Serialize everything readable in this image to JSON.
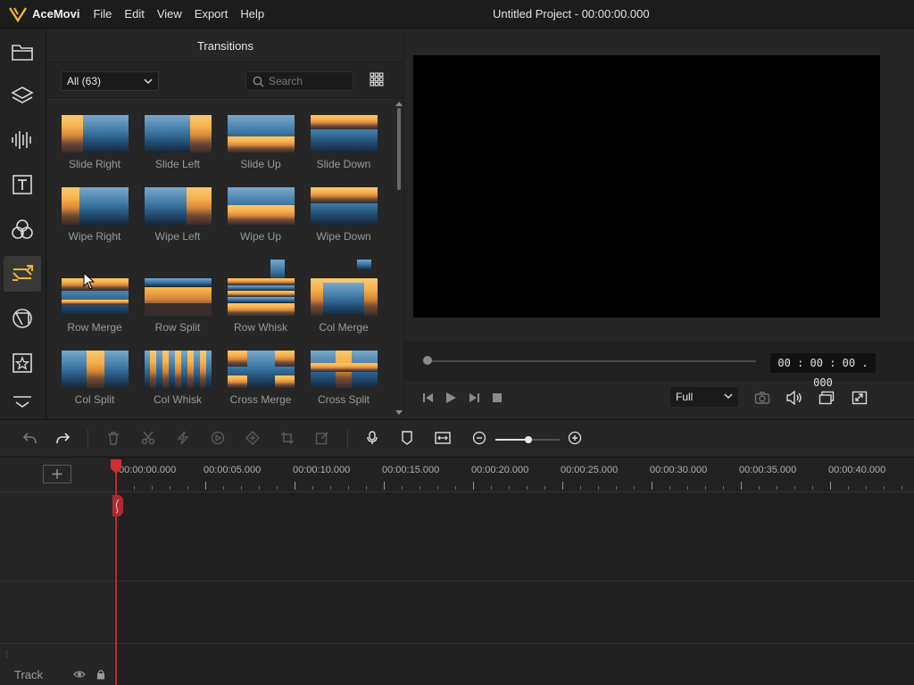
{
  "app": {
    "name": "AceMovi",
    "window_title": "Untitled Project - 00:00:00.000"
  },
  "menu": [
    "File",
    "Edit",
    "View",
    "Export",
    "Help"
  ],
  "sidebar": {
    "items": [
      {
        "icon": "folder-icon"
      },
      {
        "icon": "layers-icon"
      },
      {
        "icon": "audio-wave-icon"
      },
      {
        "icon": "text-icon"
      },
      {
        "icon": "filters-icon"
      },
      {
        "icon": "transitions-icon",
        "active": true
      },
      {
        "icon": "overlay-icon"
      },
      {
        "icon": "sticker-icon"
      },
      {
        "icon": "more-chevron-icon"
      }
    ]
  },
  "transitions": {
    "title": "Transitions",
    "filter": {
      "selected": "All (63)"
    },
    "search": {
      "placeholder": "Search"
    },
    "items": [
      {
        "label": "Slide Right"
      },
      {
        "label": "Slide Left"
      },
      {
        "label": "Slide Up"
      },
      {
        "label": "Slide Down"
      },
      {
        "label": "Wipe Right"
      },
      {
        "label": "Wipe Left"
      },
      {
        "label": "Wipe Up"
      },
      {
        "label": "Wipe Down"
      },
      {
        "label": "Row Merge"
      },
      {
        "label": "Row Split"
      },
      {
        "label": "Row Whisk"
      },
      {
        "label": "Col Merge"
      },
      {
        "label": "Col Split"
      },
      {
        "label": "Col Whisk"
      },
      {
        "label": "Cross Merge"
      },
      {
        "label": "Cross Split"
      }
    ]
  },
  "preview": {
    "timecode": "00 : 00 : 00 . 000",
    "zoom": "Full",
    "progress": 0
  },
  "timeline": {
    "ruler": [
      "00:00:00.000",
      "00:00:05.000",
      "00:00:10.000",
      "00:00:15.000",
      "00:00:20.000",
      "00:00:25.000",
      "00:00:30.000",
      "00:00:35.000",
      "00:00:40.000"
    ],
    "track_label": "Track"
  },
  "colors": {
    "accent": "#f5b428",
    "playhead": "#c4282c",
    "background": "#1f1f1f"
  }
}
